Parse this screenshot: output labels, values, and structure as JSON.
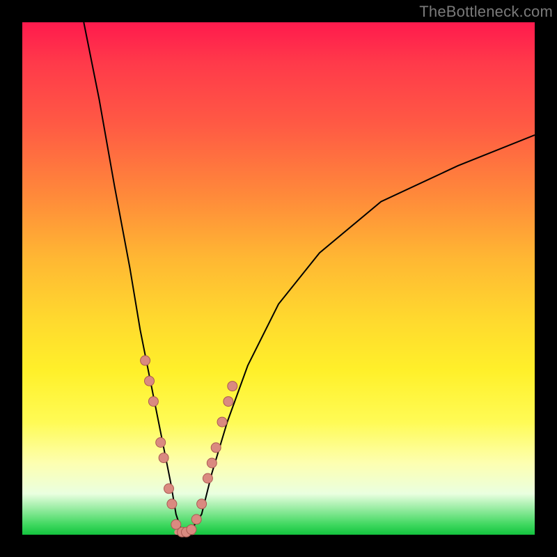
{
  "watermark": "TheBottleneck.com",
  "colors": {
    "background": "#000000",
    "gradient_top": "#ff1a4d",
    "gradient_bottom": "#13c43e",
    "curve": "#000000",
    "marker_fill": "#da8a80",
    "marker_stroke": "#aa5a52"
  },
  "chart_data": {
    "type": "line",
    "title": "",
    "xlabel": "",
    "ylabel": "",
    "xlim": [
      0,
      100
    ],
    "ylim": [
      0,
      100
    ],
    "grid": false,
    "legend": false,
    "remark": "Axis ticks and units are not shown in the source image; x and y expressed as 0–100 percent of plot area, y=0 at bottom.",
    "series": [
      {
        "name": "bottleneck-curve",
        "x": [
          12,
          15,
          18,
          21,
          23,
          25,
          27,
          29,
          30,
          31,
          32,
          33,
          35,
          37,
          40,
          44,
          50,
          58,
          70,
          85,
          100
        ],
        "y": [
          100,
          85,
          68,
          52,
          40,
          30,
          20,
          10,
          4,
          1,
          0,
          1,
          4,
          12,
          22,
          33,
          45,
          55,
          65,
          72,
          78
        ]
      },
      {
        "name": "highlighted-points",
        "x": [
          24.0,
          24.8,
          25.6,
          27.0,
          27.6,
          28.6,
          29.2,
          30.0,
          31.2,
          32.0,
          33.0,
          34.0,
          35.0,
          36.2,
          37.0,
          37.8,
          39.0,
          40.2,
          41.0
        ],
        "y": [
          34.0,
          30.0,
          26.0,
          18.0,
          15.0,
          9.0,
          6.0,
          2.0,
          0.5,
          0.5,
          1.0,
          3.0,
          6.0,
          11.0,
          14.0,
          17.0,
          22.0,
          26.0,
          29.0
        ]
      }
    ],
    "minimum_plateau": {
      "x_start": 30.2,
      "x_end": 33.2,
      "y": 0.5
    }
  }
}
